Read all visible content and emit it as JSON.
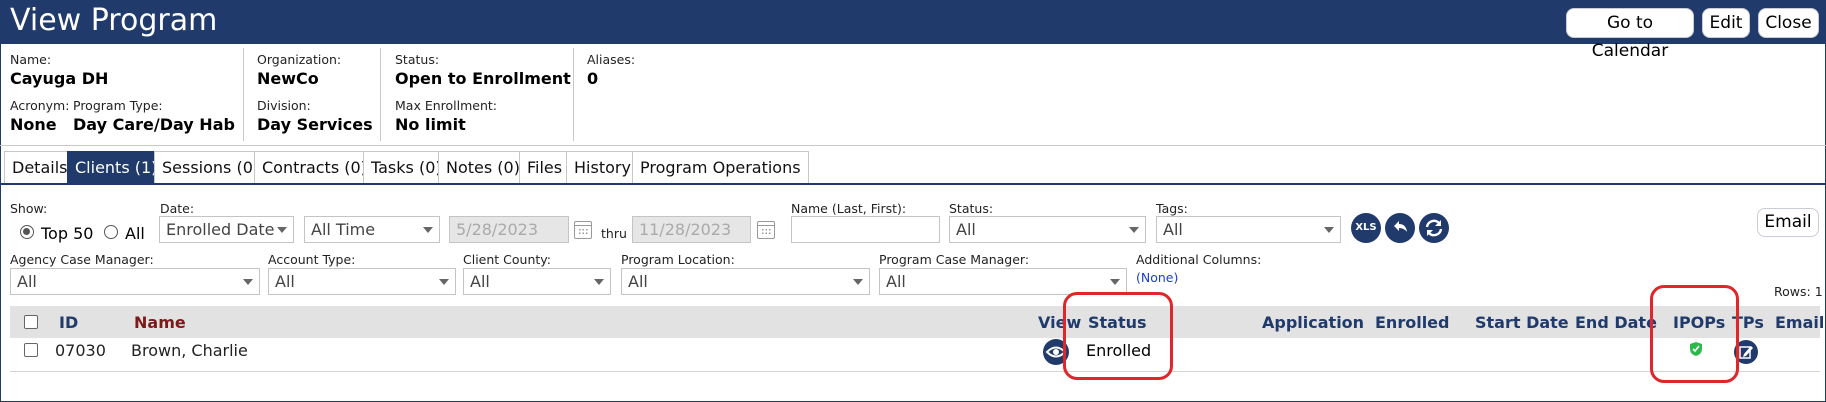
{
  "window": {
    "title": "View Program"
  },
  "header_buttons": {
    "calendar": "Go to Calendar",
    "edit": "Edit",
    "close": "Close"
  },
  "info": {
    "name_label": "Name:",
    "name": "Cayuga DH",
    "acronym_label": "Acronym:",
    "acronym": "None",
    "program_type_label": "Program Type:",
    "program_type": "Day Care/Day Hab",
    "organization_label": "Organization:",
    "organization": "NewCo",
    "division_label": "Division:",
    "division": "Day Services",
    "status_label": "Status:",
    "status": "Open to Enrollment",
    "max_enrollment_label": "Max Enrollment:",
    "max_enrollment": "No limit",
    "aliases_label": "Aliases:",
    "aliases": "0"
  },
  "tabs": [
    {
      "label": "Details",
      "active": false
    },
    {
      "label": "Clients (1)",
      "active": true
    },
    {
      "label": "Sessions (0)",
      "active": false
    },
    {
      "label": "Contracts (0)",
      "active": false
    },
    {
      "label": "Tasks (0)",
      "active": false
    },
    {
      "label": "Notes (0)",
      "active": false
    },
    {
      "label": "Files",
      "active": false
    },
    {
      "label": "History",
      "active": false
    },
    {
      "label": "Program Operations",
      "active": false
    }
  ],
  "filters": {
    "show_label": "Show:",
    "top50": "Top 50",
    "all": "All",
    "date_label": "Date:",
    "date_field": "Enrolled Date",
    "date_range": "All Time",
    "from_date": "5/28/2023",
    "thru": "thru",
    "to_date": "11/28/2023",
    "name_label": "Name (Last, First):",
    "name_value": "",
    "status_label": "Status:",
    "status_value": "All",
    "tags_label": "Tags:",
    "tags_value": "All",
    "xls": "XLS",
    "email_button": "Email",
    "agency_cm_label": "Agency Case Manager:",
    "agency_cm_value": "All",
    "account_type_label": "Account Type:",
    "account_type_value": "All",
    "county_label": "Client County:",
    "county_value": "All",
    "location_label": "Program Location:",
    "location_value": "All",
    "program_cm_label": "Program Case Manager:",
    "program_cm_value": "All",
    "additional_label": "Additional Columns:",
    "additional_value": "(None)",
    "rows": "Rows: 1"
  },
  "table": {
    "headers": {
      "id": "ID",
      "name": "Name",
      "view": "View",
      "status": "Status",
      "application": "Application",
      "enrolled": "Enrolled",
      "start_date": "Start Date",
      "end_date": "End Date",
      "ipops": "IPOPs",
      "tps": "TPs",
      "email": "Email"
    },
    "rows": [
      {
        "id": "07030",
        "name": "Brown, Charlie",
        "status": "Enrolled"
      }
    ]
  },
  "colors": {
    "primary": "#1f3a6b",
    "highlight": "#e0262b",
    "ipop_shield": "#2db84b"
  }
}
